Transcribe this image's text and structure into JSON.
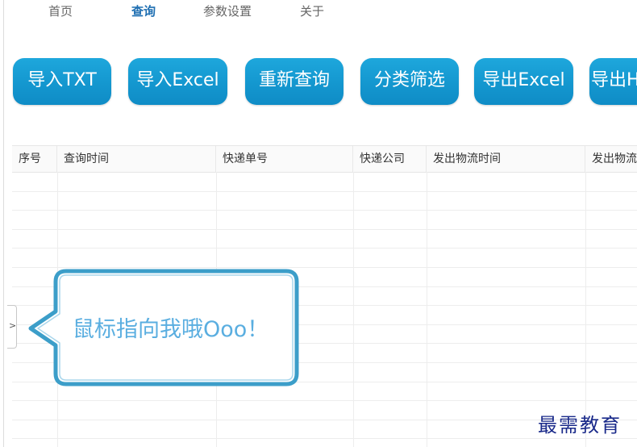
{
  "nav": {
    "items": [
      "首页",
      "查询",
      "参数设置",
      "关于"
    ],
    "active": "查询"
  },
  "toolbar": {
    "buttons": [
      "导入TXT",
      "导入Excel",
      "重新查询",
      "分类筛选",
      "导出Excel",
      "导出H"
    ]
  },
  "table": {
    "columns": [
      "序号",
      "查询时间",
      "快递单号",
      "快递公司",
      "发出物流时间",
      "发出物流"
    ]
  },
  "tooltip": {
    "text": "鼠标指向我哦Ooo！"
  },
  "side_panel": {
    "toggle_glyph": ">"
  },
  "watermark": {
    "text": "最需教育"
  },
  "colors": {
    "button_bg": "#1497cf",
    "nav_active": "#1f6fb2",
    "tooltip_text": "#5aaee0",
    "tooltip_border": "#3c9ec9"
  }
}
